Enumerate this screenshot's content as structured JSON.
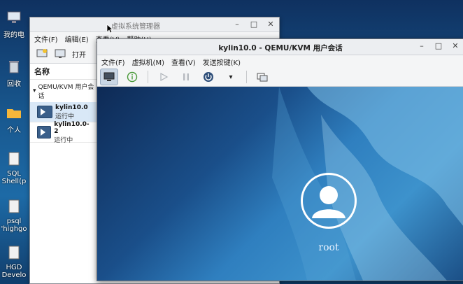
{
  "desktop": {
    "icons": [
      {
        "label": "我的电",
        "icon": "computer-icon"
      },
      {
        "label": "回收",
        "icon": "trash-icon"
      },
      {
        "label": "个人",
        "icon": "folder-icon"
      },
      {
        "label": "SQL",
        "label2": "Shell(p",
        "icon": "document-icon"
      },
      {
        "label": "psql",
        "label2": "'highgo",
        "icon": "document-icon"
      },
      {
        "label": "HGD",
        "label2": "Develo",
        "icon": "document-icon"
      }
    ]
  },
  "vmm": {
    "title": "虚拟系统管理器",
    "menu": [
      "文件(F)",
      "编辑(E)",
      "查看(V)",
      "帮助(H)"
    ],
    "toolbar": {
      "open_label": "打开"
    },
    "list_header": "名称",
    "group": "QEMU/KVM 用户会话",
    "vms": [
      {
        "name": "kylin10.0",
        "status": "运行中"
      },
      {
        "name": "kylin10.0-2",
        "status": "运行中"
      }
    ]
  },
  "kvm": {
    "title": "kylin10.0 - QEMU/KVM 用户会话",
    "menu": [
      "文件(F)",
      "虚拟机(M)",
      "查看(V)",
      "发送按键(K)"
    ],
    "login_user": "root"
  },
  "colors": {
    "accent": "#3a5f8a",
    "screen": "#1d6aa6"
  }
}
